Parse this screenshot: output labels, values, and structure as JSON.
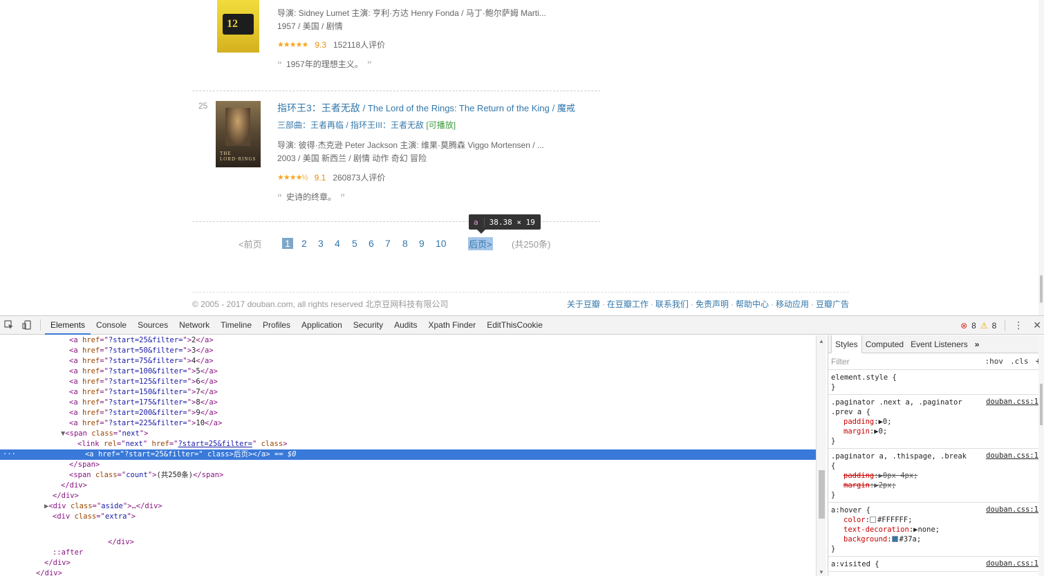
{
  "movies": [
    {
      "title": "",
      "director_line": "导演: Sidney Lumet   主演: 亨利·方达 Henry Fonda / 马丁·鲍尔萨姆 Marti...",
      "meta_line": "1957 / 美国 / 剧情",
      "stars": "★★★★★",
      "score": "9.3",
      "votes": "152118人评价",
      "quote": "1957年的理想主义。",
      "poster_colors": [
        "#e8d23a",
        "#1a1a1a"
      ]
    },
    {
      "rank": "25",
      "title": "指环王3：王者无敌",
      "other_title": "/ The Lord of the Rings: The Return of the King",
      "other_title2": "/ 魔戒",
      "alt_titles": "三部曲：王者再临 / 指环王III：王者无敌",
      "playable": "[可播放]",
      "director_line": "导演: 彼得·杰克逊 Peter Jackson   主演: 维果·莫腾森 Viggo Mortensen / ...",
      "meta_line": "2003 / 美国 新西兰 / 剧情 动作 奇幻 冒险",
      "stars": "★★★★½",
      "score": "9.1",
      "votes": "260873人评价",
      "quote": "史诗的终章。",
      "poster_colors": [
        "#6b5a3e",
        "#2a2520"
      ]
    }
  ],
  "quote_open": "“",
  "quote_close": "”",
  "paginator": {
    "prev": "<前页",
    "current": "1",
    "pages": [
      "2",
      "3",
      "4",
      "5",
      "6",
      "7",
      "8",
      "9",
      "10"
    ],
    "next": "后页>",
    "count": "(共250条)"
  },
  "tooltip": {
    "tag": "a",
    "size": "38.38 × 19"
  },
  "footer": {
    "copyright": "© 2005 - 2017 douban.com, all rights reserved 北京豆网科技有限公司",
    "links": [
      "关于豆瓣",
      "在豆瓣工作",
      "联系我们",
      "免责声明",
      "帮助中心",
      "移动应用",
      "豆瓣广告"
    ],
    "sep": "·"
  },
  "devtools": {
    "tabs": [
      "Elements",
      "Console",
      "Sources",
      "Network",
      "Timeline",
      "Profiles",
      "Application",
      "Security",
      "Audits",
      "Xpath Finder",
      "EditThisCookie"
    ],
    "active_tab": "Elements",
    "errors": "8",
    "warnings": "8",
    "side_tabs": [
      "Styles",
      "Computed",
      "Event Listeners"
    ],
    "filter_placeholder": "Filter",
    "hov": ":hov",
    "cls": ".cls",
    "page_links": [
      {
        "href": "?start=25&filter=",
        "text": "2"
      },
      {
        "href": "?start=50&filter=",
        "text": "3"
      },
      {
        "href": "?start=75&filter=",
        "text": "4"
      },
      {
        "href": "?start=100&filter=",
        "text": "5"
      },
      {
        "href": "?start=125&filter=",
        "text": "6"
      },
      {
        "href": "?start=150&filter=",
        "text": "7"
      },
      {
        "href": "?start=175&filter=",
        "text": "8"
      },
      {
        "href": "?start=200&filter=",
        "text": "9"
      },
      {
        "href": "?start=225&filter=",
        "text": "10"
      }
    ],
    "next_class": "next",
    "link_rel": "next",
    "link_href": "?start=25&filter=",
    "selected_href": "?start=25&filter=",
    "selected_text": "后页>",
    "selected_marker": "== $0",
    "count_class": "count",
    "count_text": "(共250条)",
    "aside_class": "aside",
    "extra_class": "extra",
    "after": "::after",
    "rules": [
      {
        "selector": "element.style {",
        "source": "",
        "decls": []
      },
      {
        "selector": ".paginator .next a, .paginator",
        "selector2": ".prev a {",
        "source": "douban.css:1",
        "decls": [
          {
            "prop": "padding",
            "val": "0;",
            "strike": false
          },
          {
            "prop": "margin",
            "val": "0;",
            "strike": false
          }
        ]
      },
      {
        "selector": ".paginator a, .thispage, .break",
        "selector2": "{",
        "source": "douban.css:1",
        "decls": [
          {
            "prop": "padding",
            "val": "0px 4px;",
            "strike": true
          },
          {
            "prop": "margin",
            "val": "2px;",
            "strike": true
          }
        ]
      },
      {
        "selector": "a:hover {",
        "source": "douban.css:1",
        "decls": [
          {
            "prop": "color",
            "val": "#FFFFFF;",
            "swatch": "#FFFFFF",
            "strike": false
          },
          {
            "prop": "text-decoration",
            "val": "none;",
            "strike": false
          },
          {
            "prop": "background",
            "val": "#37a;",
            "swatch": "#3377aa",
            "strike": false
          }
        ]
      },
      {
        "selector": "a:visited {",
        "source": "douban.css:1",
        "decls": []
      }
    ]
  }
}
